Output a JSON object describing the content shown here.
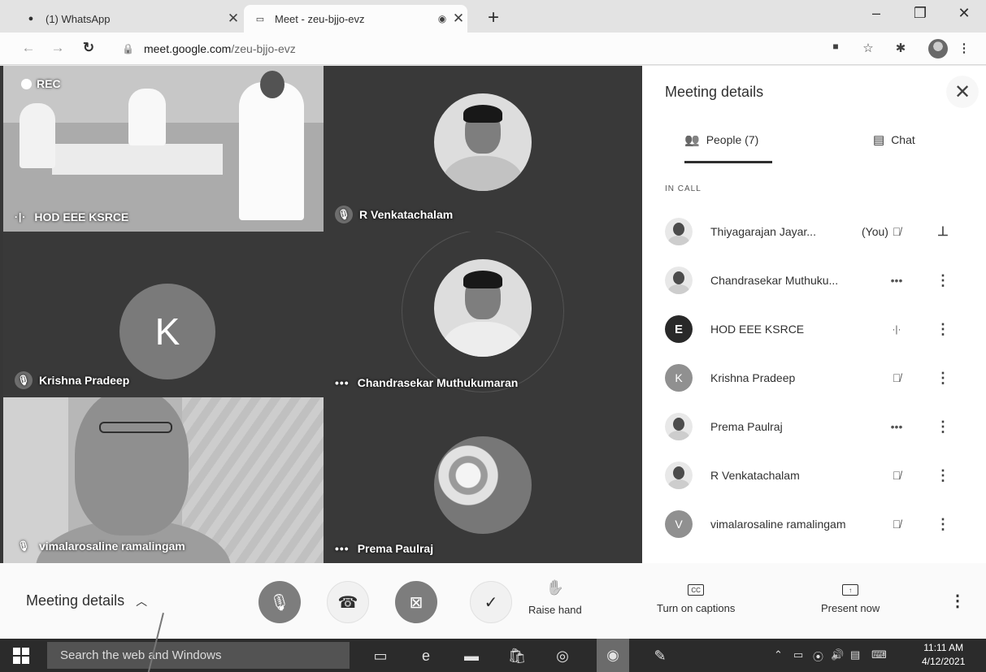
{
  "browser": {
    "tabs": [
      {
        "title": "(1) WhatsApp",
        "icon": "whatsapp-icon"
      },
      {
        "title": "Meet - zeu-bjjo-evz",
        "icon": "meet-icon"
      }
    ],
    "address": {
      "host": "meet.google.com",
      "path": "/zeu-bjjo-evz"
    }
  },
  "videos": {
    "rec_label": "REC",
    "tiles": [
      {
        "name": "HOD EEE KSRCE"
      },
      {
        "name": "R Venkatachalam"
      },
      {
        "name": "Krishna Pradeep",
        "initial": "K"
      },
      {
        "name": "Chandrasekar Muthukumaran"
      },
      {
        "name": "vimalarosaline ramalingam"
      },
      {
        "name": "Prema Paulraj"
      }
    ]
  },
  "panel": {
    "title": "Meeting details",
    "tab_people": "People (7)",
    "tab_chat": "Chat",
    "section": "IN CALL",
    "you_label": "(You)",
    "people": [
      {
        "name": "Thiyagarajan Jayar...",
        "avatar": "",
        "status": "mic-off"
      },
      {
        "name": "Chandrasekar Muthuku...",
        "avatar": "",
        "status": "..."
      },
      {
        "name": "HOD EEE KSRCE",
        "avatar": "E",
        "status": "speaking"
      },
      {
        "name": "Krishna Pradeep",
        "avatar": "K",
        "status": "mic-off"
      },
      {
        "name": "Prema Paulraj",
        "avatar": "",
        "status": "..."
      },
      {
        "name": "R Venkatachalam",
        "avatar": "",
        "status": "mic-off"
      },
      {
        "name": "vimalarosaline ramalingam",
        "avatar": "V",
        "status": "mic-off"
      }
    ]
  },
  "controls": {
    "meeting_details": "Meeting details",
    "raise_hand": "Raise hand",
    "captions": "Turn on captions",
    "present": "Present now",
    "captions_icon_text": "CC"
  },
  "taskbar": {
    "search_placeholder": "Search the web and Windows",
    "time": "11:11 AM",
    "date": "4/12/2021"
  }
}
